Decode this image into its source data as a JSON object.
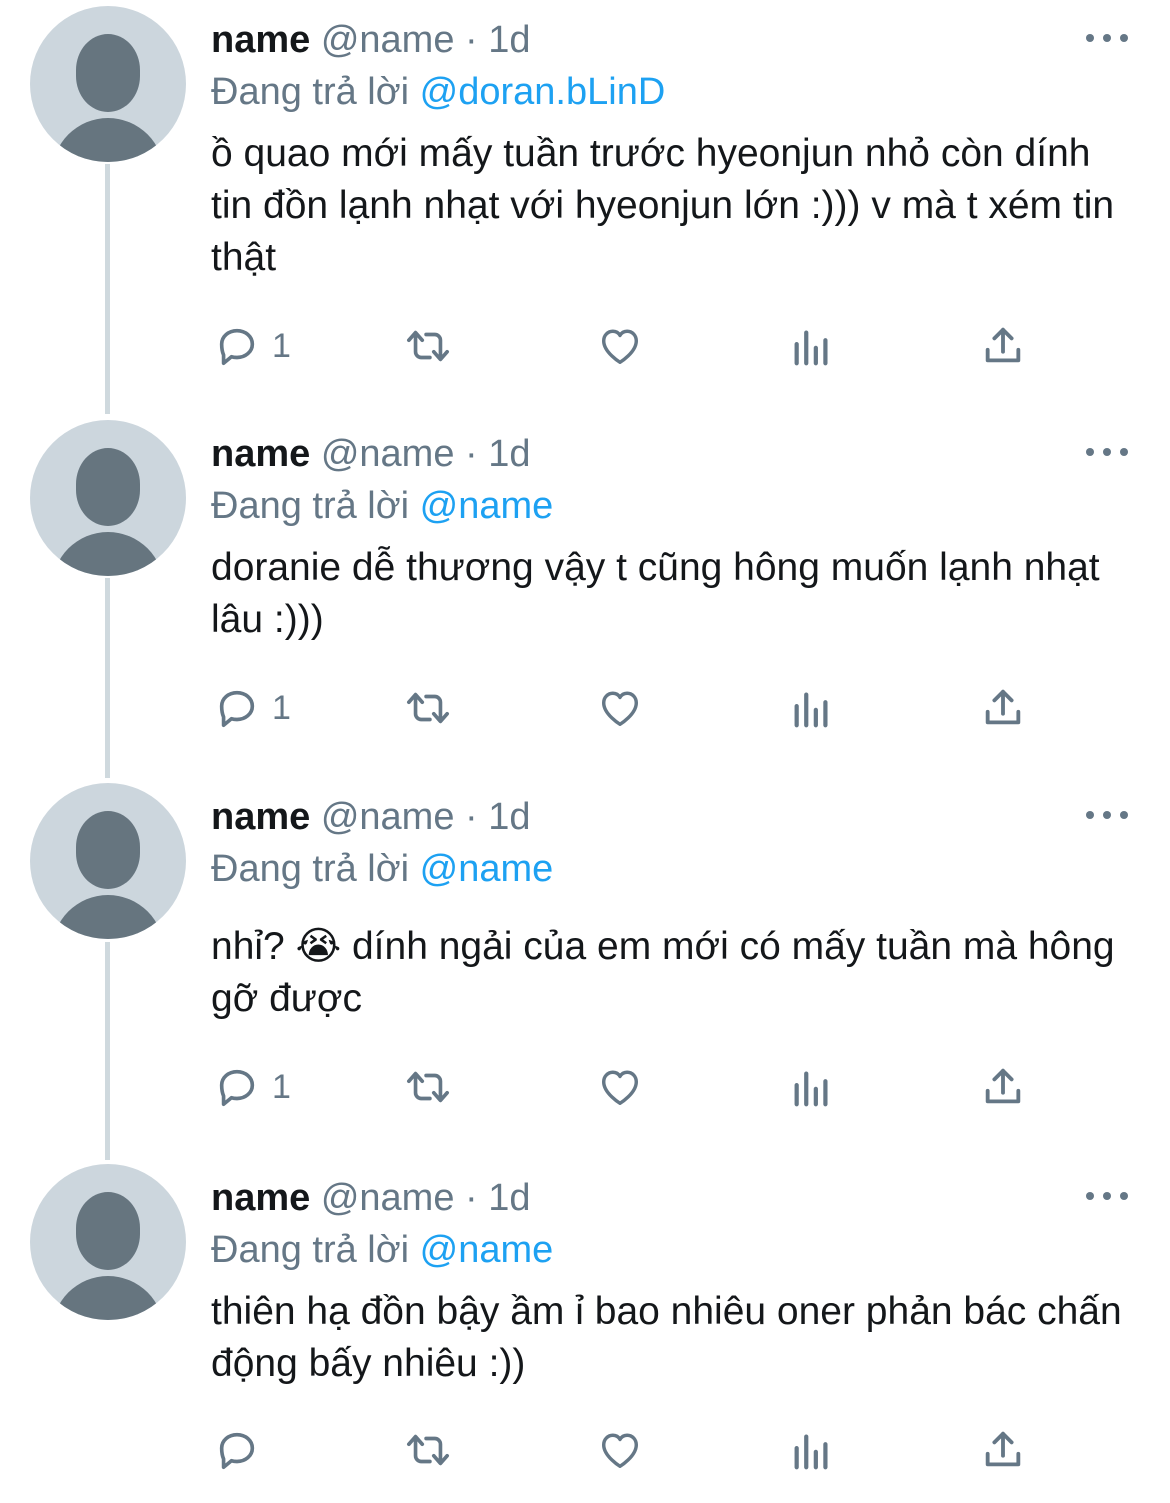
{
  "colors": {
    "accent": "#1da1f2",
    "secondary": "#657786",
    "text": "#14171a",
    "avatar_bg": "#ccd6dd"
  },
  "icons": {
    "more": "more-dots-icon",
    "reply": "reply-icon",
    "retweet": "retweet-icon",
    "like": "heart-icon",
    "views": "analytics-icon",
    "share": "share-icon"
  },
  "tweets": [
    {
      "name": "name",
      "meta": "@name · 1d",
      "reply_prefix": "Đang trả lời",
      "reply_handle": "@doran.bLinD",
      "text": "ồ quao mới mấy tuần trước hyeonjun nhỏ còn dính tin đồn lạnh nhạt với hyeonjun lớn :))) v mà t xém tin thật",
      "reply_count": "1"
    },
    {
      "name": "name",
      "meta": "@name · 1d",
      "reply_prefix": "Đang trả lời",
      "reply_handle": "@name",
      "text": "doranie dễ thương vậy t cũng hông muốn lạnh nhạt lâu :)))",
      "reply_count": "1"
    },
    {
      "name": "name",
      "meta": "@name · 1d",
      "reply_prefix": "Đang trả lời",
      "reply_handle": "@name",
      "text": "nhỉ? 😭  dính ngải của em mới có mấy tuần mà hông gỡ được",
      "reply_count": "1"
    },
    {
      "name": "name",
      "meta": "@name · 1d",
      "reply_prefix": "Đang trả lời",
      "reply_handle": "@name",
      "text": "thiên hạ đồn bậy ầm ỉ bao nhiêu oner phản bác chấn động bấy nhiêu :))",
      "reply_count": ""
    }
  ]
}
